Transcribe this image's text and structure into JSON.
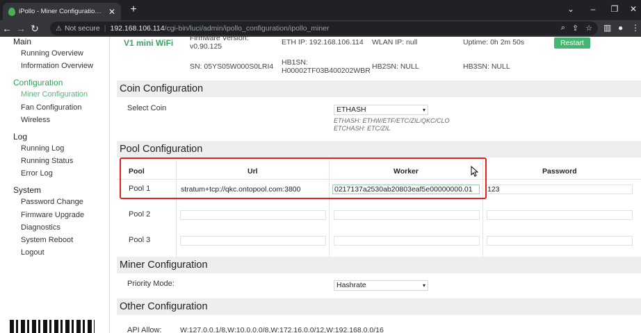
{
  "browser": {
    "tab_title": "iPollo - Miner Configuration - Lué",
    "url_secure_label": "Not secure",
    "url_host": "192.168.106.114",
    "url_path": "/cgi-bin/luci/admin/ipollo_configuration/ipollo_miner"
  },
  "sidebar": {
    "sections": [
      {
        "label": "Main",
        "items": [
          "Running Overview",
          "Information Overview"
        ]
      },
      {
        "label": "Configuration",
        "items": [
          "Miner Configuration",
          "Fan Configuration",
          "Wireless"
        ]
      },
      {
        "label": "Log",
        "items": [
          "Running Log",
          "Running Status",
          "Error Log"
        ]
      },
      {
        "label": "System",
        "items": [
          "Password Change",
          "Firmware Upgrade",
          "Diagnostics",
          "System Reboot",
          "Logout"
        ]
      }
    ]
  },
  "status": {
    "model": "V1 mini WiFi",
    "firmware_label": "Firmware Version:",
    "firmware_value": "v0.90.125",
    "eth_ip": "ETH IP: 192.168.106.114",
    "wlan_ip": "WLAN IP: null",
    "uptime": "Uptime: 0h 2m 50s",
    "restart_label": "Restart",
    "sn": "SN: 05YS05W000S0LRI4",
    "hb1sn_label": "HB1SN:",
    "hb1sn_value": "H00002TF03B400202WBR",
    "hb2sn": "HB2SN: NULL",
    "hb3sn": "HB3SN: NULL"
  },
  "coin": {
    "heading": "Coin Configuration",
    "select_label": "Select Coin",
    "selected": "ETHASH",
    "hint1": "ETHASH: ETHW/ETF/ETC/ZIL/QKC/CLO",
    "hint2": "ETCHASH: ETC/ZIL"
  },
  "pool": {
    "heading": "Pool Configuration",
    "columns": [
      "Pool",
      "Url",
      "Worker",
      "Password"
    ],
    "rows": [
      {
        "name": "Pool 1",
        "url": "stratum+tcp://qkc.ontopool.com:3800",
        "worker": "0217137a2530ab20803eaf5e00000000.01",
        "password": "123"
      },
      {
        "name": "Pool 2",
        "url": "",
        "worker": "",
        "password": ""
      },
      {
        "name": "Pool 3",
        "url": "",
        "worker": "",
        "password": ""
      }
    ]
  },
  "miner": {
    "heading": "Miner Configuration",
    "priority_label": "Priority Mode:",
    "priority_value": "Hashrate"
  },
  "other": {
    "heading": "Other Configuration",
    "api_label": "API Allow:",
    "api_value": "W:127.0.0.1/8,W:10.0.0.0/8,W:172.16.0.0/12,W:192.168.0.0/16"
  },
  "colors": {
    "accent": "#2d9e58",
    "highlight_box": "#e0211f"
  }
}
